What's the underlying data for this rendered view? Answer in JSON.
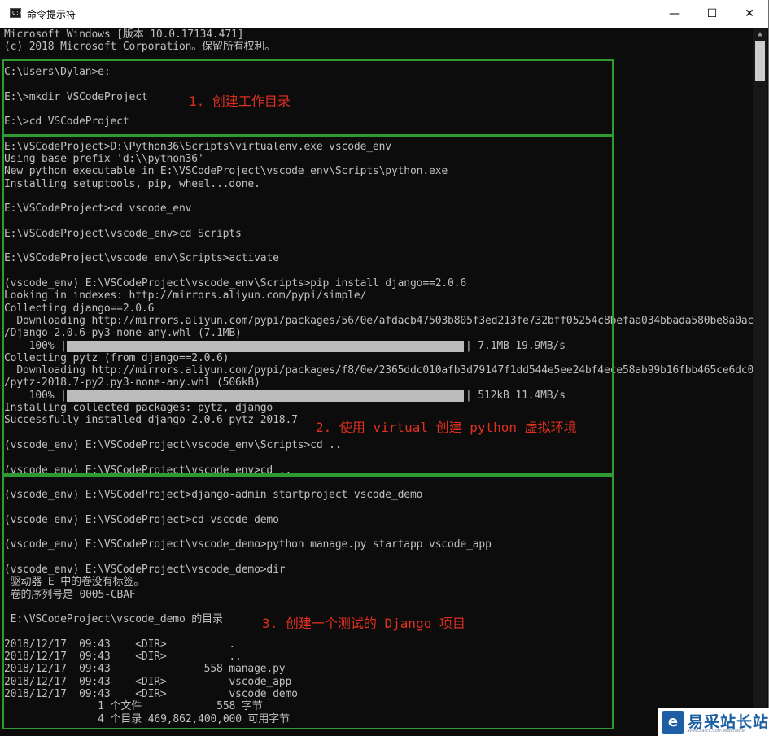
{
  "window": {
    "title": "命令提示符",
    "icon_text": "C:\\",
    "min_icon": "—",
    "max_icon": "☐",
    "close_icon": "✕"
  },
  "console_lines": [
    "Microsoft Windows [版本 10.0.17134.471]",
    "(c) 2018 Microsoft Corporation。保留所有权利。",
    "",
    "C:\\Users\\Dylan>e:",
    "",
    "E:\\>mkdir VSCodeProject",
    "",
    "E:\\>cd VSCodeProject",
    "",
    "E:\\VSCodeProject>D:\\Python36\\Scripts\\virtualenv.exe vscode_env",
    "Using base prefix 'd:\\\\python36'",
    "New python executable in E:\\VSCodeProject\\vscode_env\\Scripts\\python.exe",
    "Installing setuptools, pip, wheel...done.",
    "",
    "E:\\VSCodeProject>cd vscode_env",
    "",
    "E:\\VSCodeProject\\vscode_env>cd Scripts",
    "",
    "E:\\VSCodeProject\\vscode_env\\Scripts>activate",
    "",
    "(vscode_env) E:\\VSCodeProject\\vscode_env\\Scripts>pip install django==2.0.6",
    "Looking in indexes: http://mirrors.aliyun.com/pypi/simple/",
    "Collecting django==2.0.6",
    "  Downloading http://mirrors.aliyun.com/pypi/packages/56/0e/afdacb47503b805f3ed213fe732bff05254c8befaa034bbada580be8a0ac",
    "/Django-2.0.6-py3-none-any.whl (7.1MB)",
    "    100% |",
    "Collecting pytz (from django==2.0.6)",
    "  Downloading http://mirrors.aliyun.com/pypi/packages/f8/0e/2365ddc010afb3d79147f1dd544e5ee24bf4ece58ab99b16fbb465ce6dc0",
    "/pytz-2018.7-py2.py3-none-any.whl (506kB)",
    "    100% |",
    "Installing collected packages: pytz, django",
    "Successfully installed django-2.0.6 pytz-2018.7",
    "",
    "(vscode_env) E:\\VSCodeProject\\vscode_env\\Scripts>cd ..",
    "",
    "(vscode_env) E:\\VSCodeProject\\vscode_env>cd ..",
    "",
    "(vscode_env) E:\\VSCodeProject>django-admin startproject vscode_demo",
    "",
    "(vscode_env) E:\\VSCodeProject>cd vscode_demo",
    "",
    "(vscode_env) E:\\VSCodeProject\\vscode_demo>python manage.py startapp vscode_app",
    "",
    "(vscode_env) E:\\VSCodeProject\\vscode_demo>dir",
    " 驱动器 E 中的卷没有标签。",
    " 卷的序列号是 0005-CBAF",
    "",
    " E:\\VSCodeProject\\vscode_demo 的目录",
    "",
    "2018/12/17  09:43    <DIR>          .",
    "2018/12/17  09:43    <DIR>          ..",
    "2018/12/17  09:43               558 manage.py",
    "2018/12/17  09:43    <DIR>          vscode_app",
    "2018/12/17  09:43    <DIR>          vscode_demo",
    "               1 个文件            558 字节",
    "               4 个目录 469,862,400,000 可用字节"
  ],
  "progress": [
    {
      "percent": 100,
      "tail": "| 7.1MB 19.9MB/s"
    },
    {
      "percent": 100,
      "tail": "| 512kB 11.4MB/s"
    }
  ],
  "annotations": {
    "step1": "1. 创建工作目录",
    "step2": "2. 使用 virtual 创建 python 虚拟环境",
    "step3": "3. 创建一个测试的 Django 项目"
  },
  "watermark": {
    "badge": "e",
    "name": "易采站长站",
    "sub": "Www.Easck.Com Webmaster"
  },
  "colors": {
    "console_bg": "#0c0c0c",
    "console_text": "#c0c0c0",
    "frame": "#2f9a2f",
    "annotation": "#e03020",
    "watermark": "#1c5fa5"
  }
}
